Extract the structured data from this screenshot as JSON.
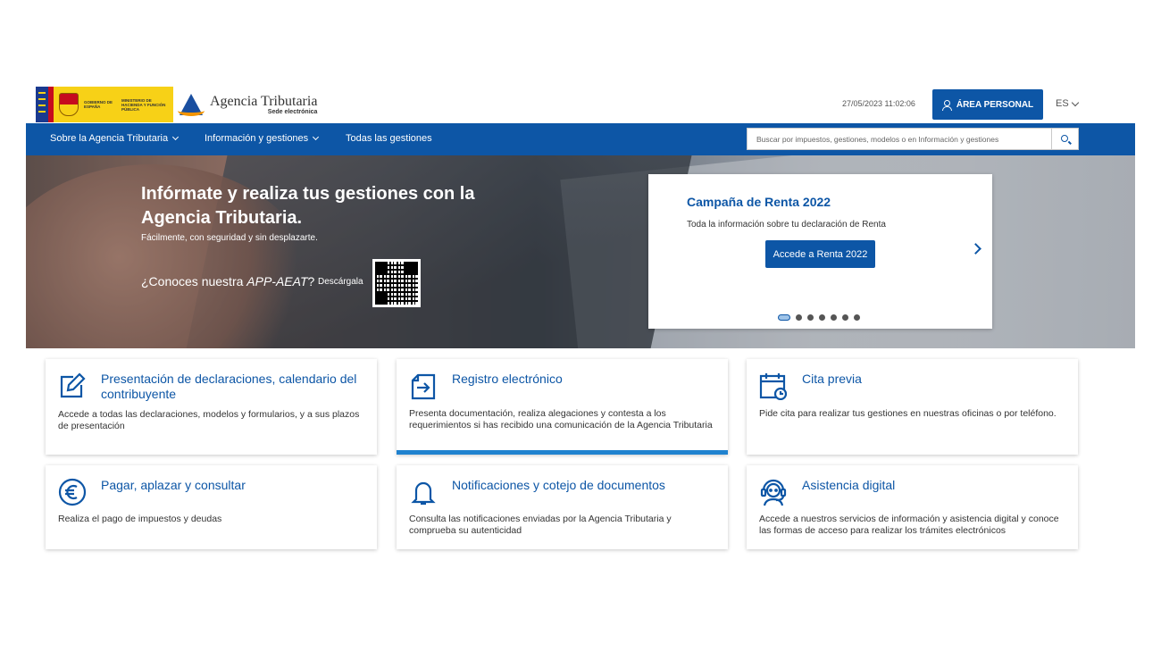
{
  "header": {
    "gov_text_1": "GOBIERNO DE ESPAÑA",
    "gov_text_2": "MINISTERIO DE HACIENDA Y FUNCIÓN PÚBLICA",
    "brand_name": "Agencia Tributaria",
    "brand_sub": "Sede electrónica",
    "datetime": "27/05/2023 11:02:06",
    "area_personal_label": "ÁREA PERSONAL",
    "language": "ES"
  },
  "nav": {
    "items": [
      {
        "label": "Sobre la Agencia Tributaria"
      },
      {
        "label": "Información y gestiones"
      },
      {
        "label": "Todas las gestiones"
      }
    ],
    "search_placeholder": "Buscar por impuestos, gestiones, modelos o en Información y gestiones"
  },
  "hero": {
    "title": "Infórmate y realiza tus gestiones con la Agencia Tributaria.",
    "subtitle": "Fácilmente, con seguridad y sin desplazarte.",
    "app_question_prefix": "¿Conoces nuestra ",
    "app_name": "APP-AEAT",
    "app_question_suffix": "?",
    "download_label": "Descárgala"
  },
  "campaign": {
    "title": "Campaña de Renta 2022",
    "text": "Toda la información sobre tu declaración de Renta",
    "button_label": "Accede a Renta 2022",
    "slide_count": 7,
    "active_slide": 1
  },
  "cards": [
    {
      "title": "Presentación de declaraciones, calendario del contribuyente",
      "desc": "Accede a todas las declaraciones, modelos y formularios, y a sus plazos de presentación",
      "icon": "edit-icon"
    },
    {
      "title": "Registro electrónico",
      "desc": "Presenta documentación, realiza alegaciones y contesta a los requerimientos si has recibido una comunicación de la Agencia Tributaria",
      "icon": "register-icon"
    },
    {
      "title": "Cita previa",
      "desc": "Pide cita para realizar tus gestiones en nuestras oficinas o por teléfono.",
      "icon": "calendar-clock-icon"
    },
    {
      "title": "Pagar, aplazar y consultar",
      "desc": "Realiza el pago de impuestos y deudas",
      "icon": "euro-icon"
    },
    {
      "title": "Notificaciones y cotejo de documentos",
      "desc": "Consulta las notificaciones enviadas por la Agencia Tributaria y comprueba su autenticidad",
      "icon": "bell-icon"
    },
    {
      "title": "Asistencia digital",
      "desc": "Accede a nuestros servicios de información y asistencia digital y conoce las formas de acceso para realizar los trámites electrónicos",
      "icon": "headset-icon"
    }
  ],
  "colors": {
    "primary": "#0d56a6",
    "accent_bar": "#1f82cf",
    "gov_yellow": "#f7d117"
  }
}
